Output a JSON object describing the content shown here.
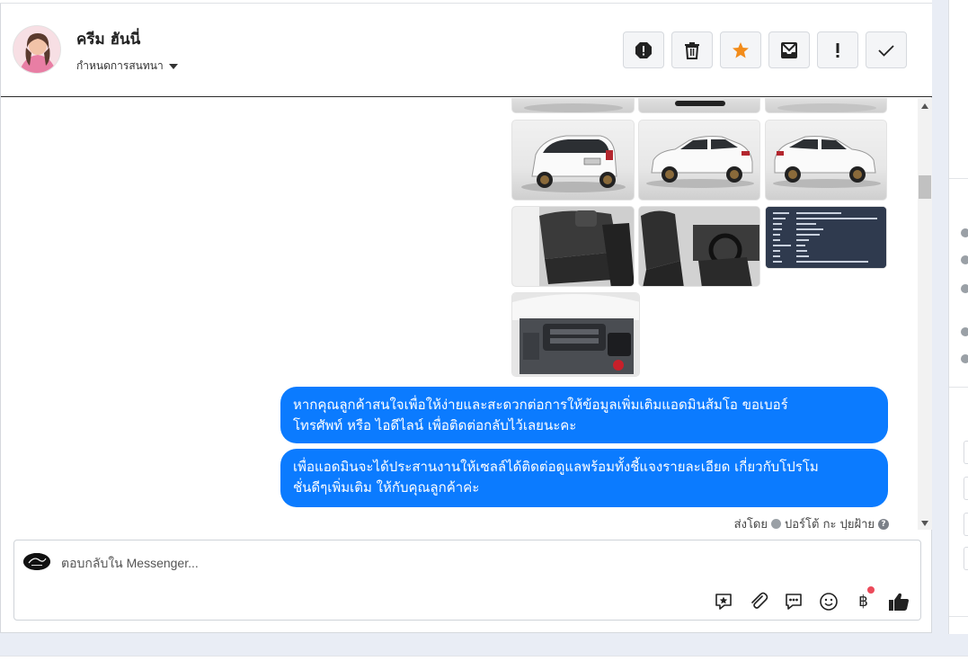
{
  "contact": {
    "name": "ครีม ฮันนี่",
    "assign_label": "กำหนดการสนทนา"
  },
  "toolbar": {
    "actions": [
      "spam",
      "delete",
      "star",
      "archive",
      "important",
      "done"
    ]
  },
  "conversation": {
    "messages": [
      "หากคุณลูกค้าสนใจเพื่อให้ง่ายและสะดวกต่อการให้ข้อมูลเพิ่มเติมแอดมินส้มโอ ขอเบอร์โทรศัพท์ หรือ ไอดีไลน์ เพื่อติดต่อกลับไว้เลยนะคะ",
      "เพื่อแอดมินจะได้ประสานงานให้เซลล์ได้ติดต่อดูแลพร้อมทั้งชี้แจงรายละเอียด เกี่ยวกับโปรโมชั่นดีๆเพิ่มเติม ให้กับคุณลูกค้าค่ะ"
    ],
    "message_lines": [
      [
        "หากคุณลูกค้าสนใจเพื่อให้ง่ายและสะดวกต่อการให้ข้อมูลเพิ่มเติมแอดมินส้มโอ ขอเบอร์",
        "โทรศัพท์ หรือ ไอดีไลน์ เพื่อติดต่อกลับไว้เลยนะคะ"
      ],
      [
        "เพื่อแอดมินจะได้ประสานงานให้เซลล์ได้ติดต่อดูแลพร้อมทั้งชี้แจงรายละเอียด เกี่ยวกับโปรโม",
        "ชั่นดีๆเพิ่มเติม ให้กับคุณลูกค้าค่ะ"
      ]
    ],
    "sent_by_label": "ส่งโดย",
    "sender_name": "ปอร์โต้ กะ ปุยฝ้าย"
  },
  "composer": {
    "placeholder": "ตอบกลับใน Messenger...",
    "tools": [
      "saved-reply",
      "attachment",
      "quick-reply",
      "emoji",
      "payment",
      "like"
    ],
    "payment_symbol": "฿"
  },
  "colors": {
    "bubble": "#0b7bff",
    "star": "#f28c1b",
    "notification_dot": "#ec4a5a"
  }
}
